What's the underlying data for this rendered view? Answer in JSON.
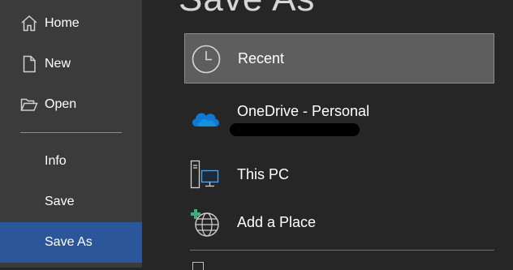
{
  "page": {
    "title": "Save As"
  },
  "nav": {
    "items": [
      {
        "id": "home",
        "label": "Home",
        "icon": "home-icon"
      },
      {
        "id": "new",
        "label": "New",
        "icon": "new-document-icon"
      },
      {
        "id": "open",
        "label": "Open",
        "icon": "open-folder-icon"
      },
      {
        "id": "info",
        "label": "Info"
      },
      {
        "id": "save",
        "label": "Save"
      },
      {
        "id": "saveas",
        "label": "Save As",
        "active": true
      }
    ],
    "active_color": "#2b579a"
  },
  "locations": {
    "recent": {
      "label": "Recent",
      "icon": "clock-icon",
      "selected": true
    },
    "onedrive": {
      "label": "OneDrive - Personal",
      "icon": "cloud-icon",
      "account_redacted": true
    },
    "thispc": {
      "label": "This PC",
      "icon": "computer-icon"
    },
    "addplace": {
      "label": "Add a Place",
      "icon": "globe-add-icon"
    }
  },
  "colors": {
    "sidebar_bg": "#3b3b3b",
    "main_bg": "#262626",
    "selected_bg": "#5e5e5e",
    "onedrive_blue": "#0f78d4"
  }
}
